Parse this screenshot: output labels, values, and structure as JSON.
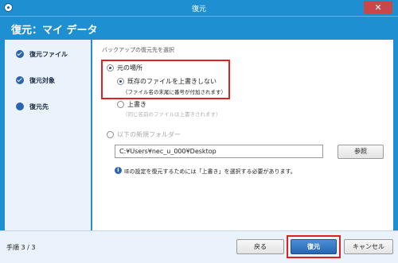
{
  "window": {
    "title": "復元",
    "close_label": "✕"
  },
  "header": {
    "title": "復元：マイ データ"
  },
  "sidebar": {
    "items": [
      {
        "label": "復元ファイル",
        "state": "done"
      },
      {
        "label": "復元対象",
        "state": "done"
      },
      {
        "label": "復元先",
        "state": "current"
      }
    ]
  },
  "main": {
    "section_label": "バックアップの復元先を選択",
    "original_location": {
      "label": "元の場所",
      "options": [
        {
          "label": "既存のファイルを上書きしない",
          "note": "（ファイル名の末尾に番号が付加されます）",
          "selected": true
        },
        {
          "label": "上書き",
          "note": "（同じ名前のファイルは上書きされます）",
          "selected": false
        }
      ]
    },
    "new_folder": {
      "label": "以下の新規フォルダー",
      "path_value": "C:¥Users¥nec_u_000¥Desktop",
      "browse_label": "参照"
    },
    "info_text": "IEの設定を復元するためには「上書き」を選択する必要があります。"
  },
  "footer": {
    "step_text": "手順 3 / 3",
    "back_label": "戻る",
    "restore_label": "復元",
    "cancel_label": "キャンセル"
  },
  "colors": {
    "accent": "#1e8fd1",
    "highlight": "#e02020",
    "sidebar_bg": "#eaf2fb"
  }
}
